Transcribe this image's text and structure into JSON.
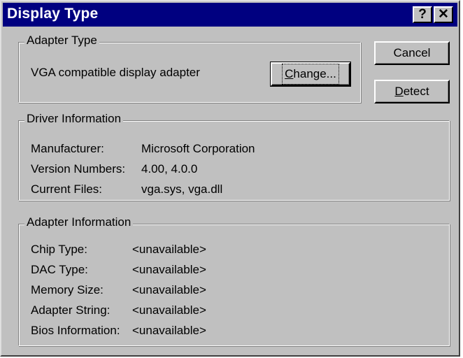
{
  "window": {
    "title": "Display Type",
    "help_button": "?",
    "close_button": "✕"
  },
  "buttons": {
    "cancel": "Cancel",
    "detect_mnemonic": "D",
    "detect_rest": "etect",
    "change_mnemonic": "C",
    "change_rest": "hange..."
  },
  "adapter_type": {
    "legend": "Adapter Type",
    "value": "VGA compatible display adapter"
  },
  "driver_info": {
    "legend": "Driver Information",
    "rows": [
      {
        "label": "Manufacturer:",
        "value": "Microsoft Corporation"
      },
      {
        "label": "Version Numbers:",
        "value": "4.00, 4.0.0"
      },
      {
        "label": "Current Files:",
        "value": "vga.sys, vga.dll"
      }
    ]
  },
  "adapter_info": {
    "legend": "Adapter Information",
    "rows": [
      {
        "label": "Chip Type:",
        "value": "<unavailable>"
      },
      {
        "label": "DAC Type:",
        "value": "<unavailable>"
      },
      {
        "label": "Memory Size:",
        "value": "<unavailable>"
      },
      {
        "label": "Adapter String:",
        "value": "<unavailable>"
      },
      {
        "label": "Bios Information:",
        "value": "<unavailable>"
      }
    ]
  },
  "colors": {
    "titlebar": "#000080",
    "face": "#c0c0c0",
    "title_text": "#ffffff"
  }
}
